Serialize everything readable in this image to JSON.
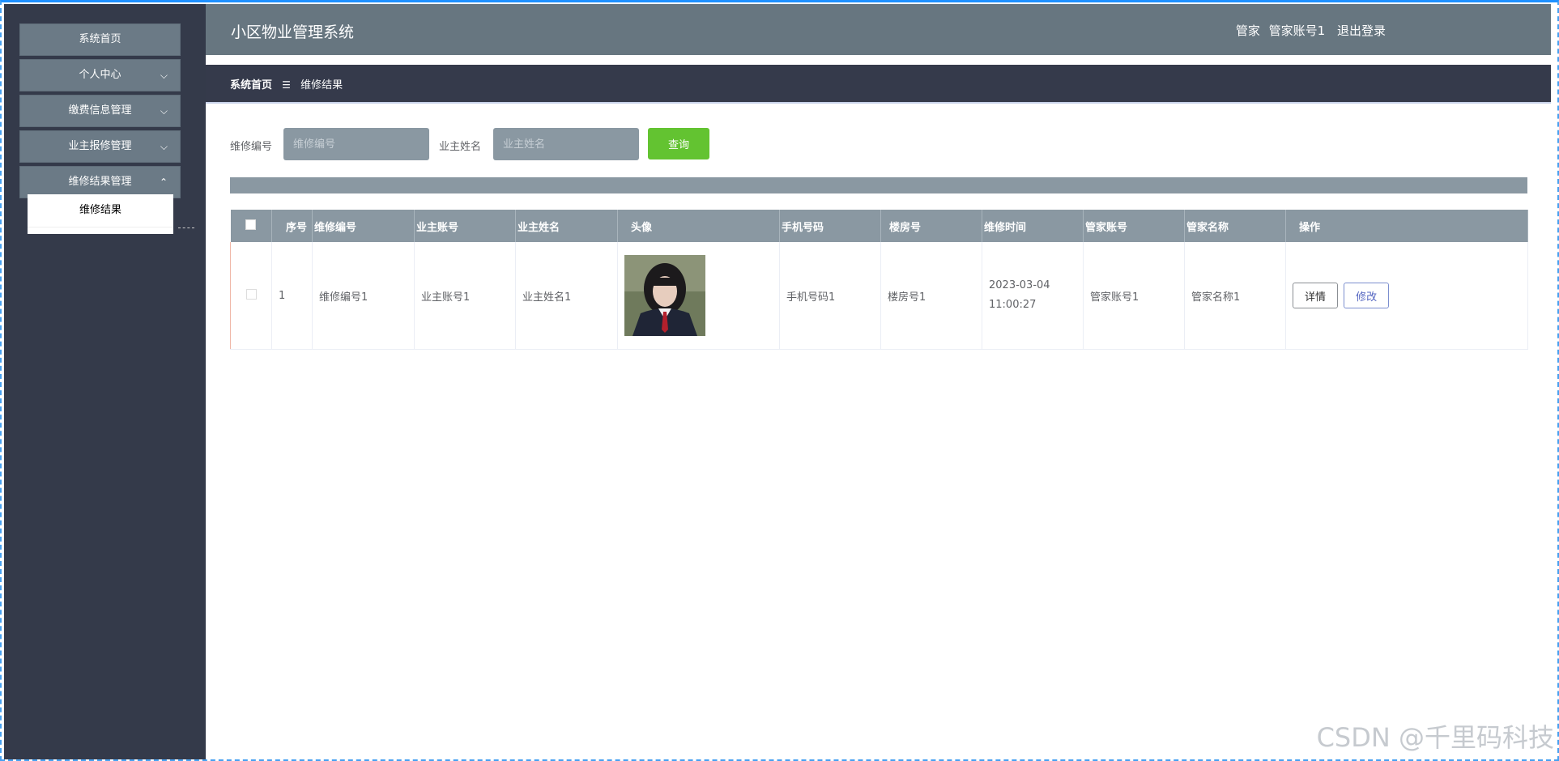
{
  "app": {
    "title": "小区物业管理系统"
  },
  "user": {
    "role": "管家",
    "account": "管家账号1",
    "logout": "退出登录"
  },
  "sidebar": {
    "items": [
      {
        "label": "系统首页",
        "chevron": ""
      },
      {
        "label": "个人中心",
        "chevron": "⌵"
      },
      {
        "label": "缴费信息管理",
        "chevron": "⌵"
      },
      {
        "label": "业主报修管理",
        "chevron": "⌵"
      },
      {
        "label": "维修结果管理",
        "chevron": "⌃"
      }
    ],
    "subitems": [
      {
        "label": "维修结果"
      }
    ]
  },
  "breadcrumb": {
    "home": "系统首页",
    "separator": "☰",
    "current": "维修结果"
  },
  "search": {
    "field1_label": "维修编号",
    "field1_placeholder": "维修编号",
    "field2_label": "业主姓名",
    "field2_placeholder": "业主姓名",
    "query_button": "查询"
  },
  "table": {
    "headers": [
      "",
      "序号",
      "维修编号",
      "业主账号",
      "业主姓名",
      "头像",
      "手机号码",
      "楼房号",
      "维修时间",
      "管家账号",
      "管家名称",
      "操作"
    ],
    "rows": [
      {
        "index": "1",
        "repair_no": "维修编号1",
        "owner_account": "业主账号1",
        "owner_name": "业主姓名1",
        "phone": "手机号码1",
        "building": "楼房号1",
        "repair_time": "2023-03-04 11:00:27",
        "steward_account": "管家账号1",
        "steward_name": "管家名称1",
        "detail_button": "详情",
        "edit_button": "修改"
      }
    ]
  },
  "watermark": "CSDN @千里码科技",
  "colors": {
    "topbar": "#677680",
    "sidebar": "#343a4a",
    "menu": "#6b7a86",
    "query_button": "#63c331"
  },
  "icons": {
    "avatar": "portrait-photo"
  }
}
